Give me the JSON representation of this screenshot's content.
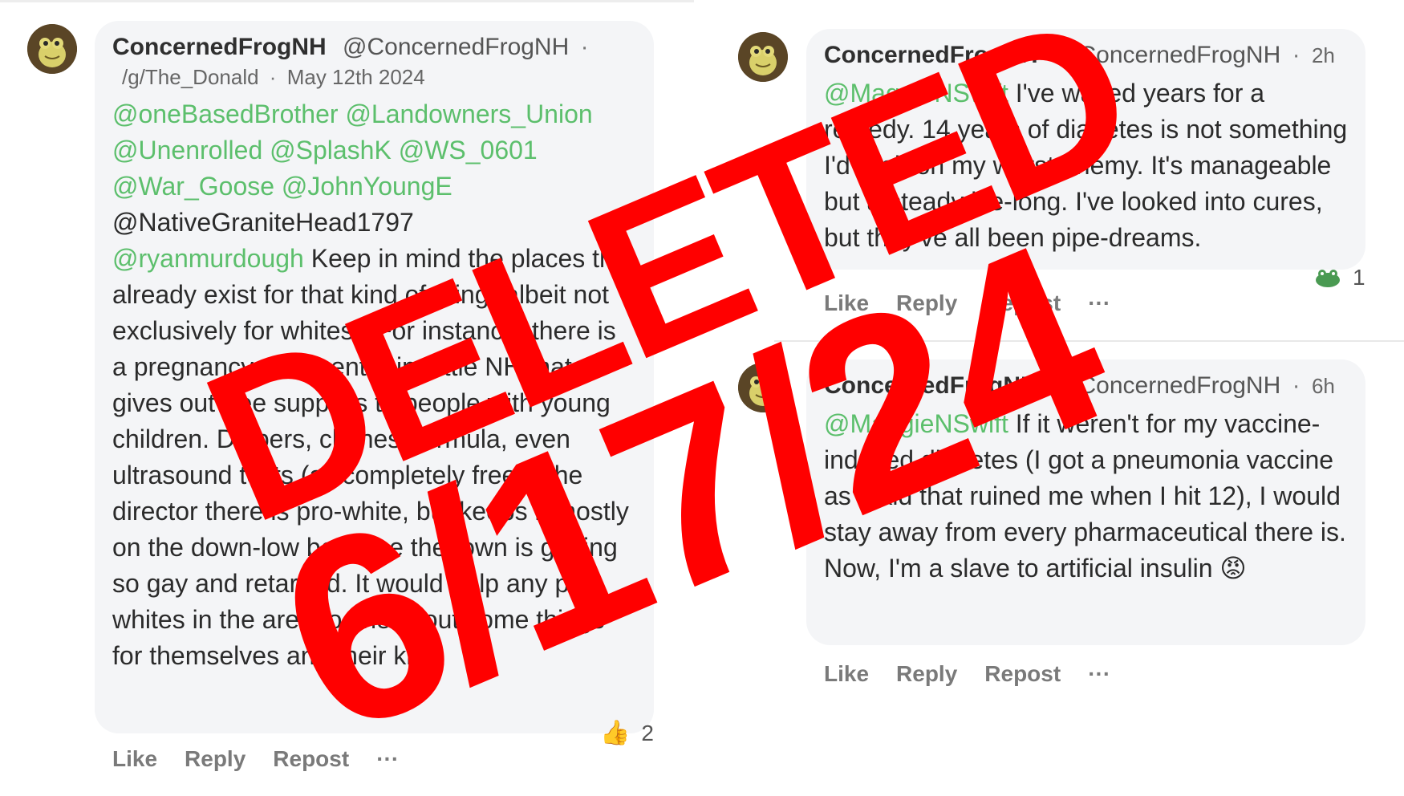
{
  "post_left": {
    "name": "ConcernedFrogNH",
    "handle": "@ConcernedFrogNH",
    "separator": "·",
    "community": "/g/The_Donald",
    "date": "May 12th 2024",
    "mentions_green_1": "@oneBasedBrother @Landowners_Union",
    "mentions_green_2": "@Unenrolled @SplashK @WS_0601",
    "mentions_green_3": "@War_Goose @JohnYoungE",
    "mention_dark": "@NativeGraniteHead1797",
    "mention_reply": "@ryanmurdough",
    "text": "Keep in mind the places that already exist for that kind of thing (albeit not exclusively for whites). For instance, there is a pregnancy care center in Little NH that gives out free supplies to people with young children. Diapers, clothes, formula, even ultrasound tests (all completely free). The director there is pro-white, but keeps it mostly on the down-low because the town is getting so gay and retarded. It would help any pro-whites in the area to check out some things for themselves and their kids.",
    "reaction_emoji": "👍",
    "reaction_count": "2",
    "actions": {
      "like": "Like",
      "reply": "Reply",
      "repost": "Repost",
      "more": "···"
    }
  },
  "post_right_top": {
    "name": "ConcernedFrogNH",
    "handle": "@ConcernedFrogNH",
    "separator": "·",
    "time": "2h",
    "mention": "@MaggieNSwift",
    "text": "I've waited years for a remedy. 14 years of diabetes is not something I'd wish on my worst enemy. It's manageable but a steady life-long. I've looked into cures, but they've all been pipe-dreams.",
    "reaction_icon": "frog-icon",
    "reaction_count": "1",
    "actions": {
      "like": "Like",
      "reply": "Reply",
      "repost": "Repost",
      "more": "···"
    }
  },
  "post_right_bottom": {
    "name": "ConcernedFrogNH",
    "handle": "@ConcernedFrogNH",
    "separator": "·",
    "time": "6h",
    "mention": "@MaggieNSwift",
    "text": "If it weren't for my vaccine-induced diabetes (I got a pneumonia vaccine as a kid that ruined me when I hit 12), I would stay away from every pharmaceutical there is. Now, I'm a slave to artificial insulin",
    "emoji": "😡",
    "actions": {
      "like": "Like",
      "reply": "Reply",
      "repost": "Repost",
      "more": "···"
    }
  },
  "stamp": {
    "line1": "DELETED",
    "line2": "6/17/24",
    "color": "#ff0000"
  },
  "colors": {
    "mention": "#5cbf6c",
    "bubble": "#f4f5f7"
  }
}
